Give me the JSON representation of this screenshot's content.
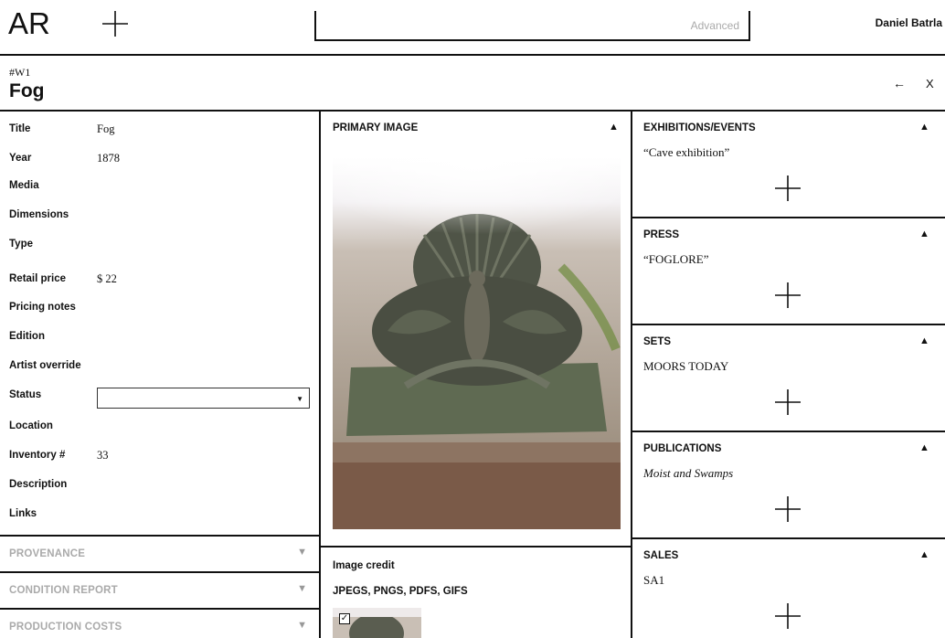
{
  "header": {
    "logo": "AR",
    "add_icon": "plus-icon",
    "search_value": "",
    "advanced_label": "Advanced",
    "user_name": "Daniel Batrla"
  },
  "record": {
    "id": "#W1",
    "title": "Fog",
    "back_icon": "arrow-left-icon",
    "close_label": "X"
  },
  "fields": [
    {
      "label": "Title",
      "value": "Fog"
    },
    {
      "label": "Year",
      "value": "1878"
    },
    {
      "label": "Media",
      "value": ""
    },
    {
      "label": "Dimensions",
      "value": ""
    },
    {
      "label": "Type",
      "value": ""
    },
    {
      "label": "Retail price",
      "value": "$  22"
    },
    {
      "label": "Pricing notes",
      "value": ""
    },
    {
      "label": "Edition",
      "value": ""
    },
    {
      "label": "Artist override",
      "value": ""
    },
    {
      "label": "Status",
      "value": ""
    },
    {
      "label": "Location",
      "value": ""
    },
    {
      "label": "Inventory #",
      "value": "33"
    },
    {
      "label": "Description",
      "value": ""
    },
    {
      "label": "Links",
      "value": ""
    }
  ],
  "collapsibles": [
    {
      "label": "PROVENANCE"
    },
    {
      "label": "CONDITION REPORT"
    },
    {
      "label": "PRODUCTION COSTS"
    }
  ],
  "media": {
    "primary_title": "PRIMARY IMAGE",
    "image_credit_label": "Image credit",
    "filetypes_label": "JPEGS, PNGS, PDFS, GIFS",
    "thumb_checked": true
  },
  "sections": [
    {
      "title": "EXHIBITIONS/EVENTS",
      "item": "“Cave exhibition”",
      "italic": false
    },
    {
      "title": "PRESS",
      "item": "“FOGLORE”",
      "italic": false
    },
    {
      "title": "SETS",
      "item": "MOORS TODAY",
      "italic": false
    },
    {
      "title": "PUBLICATIONS",
      "item": "Moist and Swamps",
      "italic": true
    },
    {
      "title": "SALES",
      "item": "SA1",
      "italic": false
    }
  ],
  "colors": {
    "ink": "#111111",
    "muted": "#aaaaaa"
  }
}
